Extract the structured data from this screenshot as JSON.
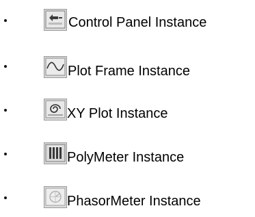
{
  "items": [
    {
      "label": "Control Panel Instance",
      "icon": "control-panel-icon"
    },
    {
      "label": "Plot Frame Instance",
      "icon": "plot-frame-icon"
    },
    {
      "label": "XY Plot Instance",
      "icon": "xy-plot-icon"
    },
    {
      "label": "PolyMeter Instance",
      "icon": "polymeter-icon"
    },
    {
      "label": "PhasorMeter Instance",
      "icon": "phasormeter-icon"
    }
  ]
}
